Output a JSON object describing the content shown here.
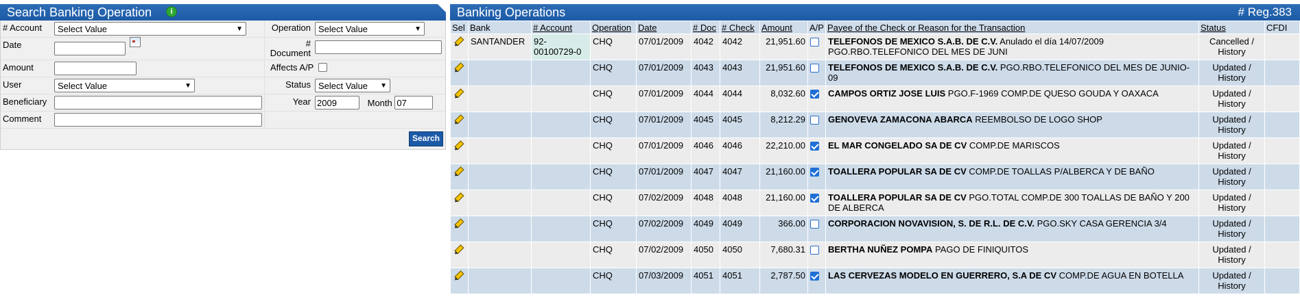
{
  "search": {
    "title": "Search Banking Operation",
    "account_label": "# Account",
    "account_value": "Select Value",
    "operation_label": "Operation",
    "operation_value": "Select Value",
    "date_label": "Date",
    "date_value": "",
    "document_label": "# Document",
    "document_value": "",
    "amount_label": "Amount",
    "amount_value": "",
    "affects_label": "Affects A/P",
    "user_label": "User",
    "user_value": "Select Value",
    "status_label": "Status",
    "status_value": "Select Value",
    "beneficiary_label": "Beneficiary",
    "beneficiary_value": "",
    "year_label": "Year",
    "year_value": "2009",
    "month_label": "Month",
    "month_value": "07",
    "comment_label": "Comment",
    "comment_value": "",
    "search_button": "Search"
  },
  "ops": {
    "title": "Banking Operations",
    "reg": "# Reg.383",
    "columns": [
      "Sel",
      "Bank",
      "# Account",
      "Operation",
      "Date",
      "# Doc",
      "# Check",
      "Amount",
      "A/P",
      "Payee of the Check or Reason for the Transaction",
      "Status",
      "CFDI"
    ],
    "rows": [
      {
        "bank": "SANTANDER",
        "account": "92-00100729-0",
        "op": "CHQ",
        "date": "07/01/2009",
        "doc": "4042",
        "check": "4042",
        "amount": "21,951.60",
        "ap": false,
        "payee": "TELEFONOS DE MEXICO S.A.B. DE C.V.",
        "reason": " Anulado el día 14/07/2009 PGO.RBO.TELEFONICO DEL MES DE JUNI",
        "status": "Cancelled / History"
      },
      {
        "bank": "",
        "account": "",
        "op": "CHQ",
        "date": "07/01/2009",
        "doc": "4043",
        "check": "4043",
        "amount": "21,951.60",
        "ap": false,
        "payee": "TELEFONOS DE MEXICO S.A.B. DE C.V.",
        "reason": " PGO.RBO.TELEFONICO DEL MES DE JUNIO-09",
        "status": "Updated / History"
      },
      {
        "bank": "",
        "account": "",
        "op": "CHQ",
        "date": "07/01/2009",
        "doc": "4044",
        "check": "4044",
        "amount": "8,032.60",
        "ap": true,
        "payee": "CAMPOS ORTIZ JOSE LUIS",
        "reason": " PGO.F-1969 COMP.DE QUESO GOUDA Y OAXACA",
        "status": "Updated / History"
      },
      {
        "bank": "",
        "account": "",
        "op": "CHQ",
        "date": "07/01/2009",
        "doc": "4045",
        "check": "4045",
        "amount": "8,212.29",
        "ap": false,
        "payee": "GENOVEVA ZAMACONA ABARCA",
        "reason": " REEMBOLSO DE LOGO SHOP",
        "status": "Updated / History"
      },
      {
        "bank": "",
        "account": "",
        "op": "CHQ",
        "date": "07/01/2009",
        "doc": "4046",
        "check": "4046",
        "amount": "22,210.00",
        "ap": true,
        "payee": "EL MAR CONGELADO SA DE CV",
        "reason": " COMP.DE MARISCOS",
        "status": "Updated / History"
      },
      {
        "bank": "",
        "account": "",
        "op": "CHQ",
        "date": "07/01/2009",
        "doc": "4047",
        "check": "4047",
        "amount": "21,160.00",
        "ap": true,
        "payee": "TOALLERA POPULAR SA DE CV",
        "reason": " COMP.DE TOALLAS P/ALBERCA Y DE BAÑO",
        "status": "Updated / History"
      },
      {
        "bank": "",
        "account": "",
        "op": "CHQ",
        "date": "07/02/2009",
        "doc": "4048",
        "check": "4048",
        "amount": "21,160.00",
        "ap": true,
        "payee": "TOALLERA POPULAR SA DE CV",
        "reason": " PGO.TOTAL COMP.DE 300 TOALLAS DE BAÑO Y 200 DE ALBERCA",
        "status": "Updated / History"
      },
      {
        "bank": "",
        "account": "",
        "op": "CHQ",
        "date": "07/02/2009",
        "doc": "4049",
        "check": "4049",
        "amount": "366.00",
        "ap": false,
        "payee": "CORPORACION NOVAVISION, S. DE R.L. DE C.V.",
        "reason": " PGO.SKY CASA GERENCIA 3/4",
        "status": "Updated / History"
      },
      {
        "bank": "",
        "account": "",
        "op": "CHQ",
        "date": "07/02/2009",
        "doc": "4050",
        "check": "4050",
        "amount": "7,680.31",
        "ap": false,
        "payee": "BERTHA NUÑEZ POMPA",
        "reason": " PAGO DE FINIQUITOS",
        "status": "Updated / History"
      },
      {
        "bank": "",
        "account": "",
        "op": "CHQ",
        "date": "07/03/2009",
        "doc": "4051",
        "check": "4051",
        "amount": "2,787.50",
        "ap": true,
        "payee": "LAS CERVEZAS MODELO EN GUERRERO, S.A DE CV",
        "reason": " COMP.DE AGUA EN BOTELLA",
        "status": "Updated / History"
      }
    ]
  },
  "colors": {
    "header_bg": "#1c5aa6",
    "row_even": "#cddbe9",
    "row_odd": "#ececec"
  }
}
